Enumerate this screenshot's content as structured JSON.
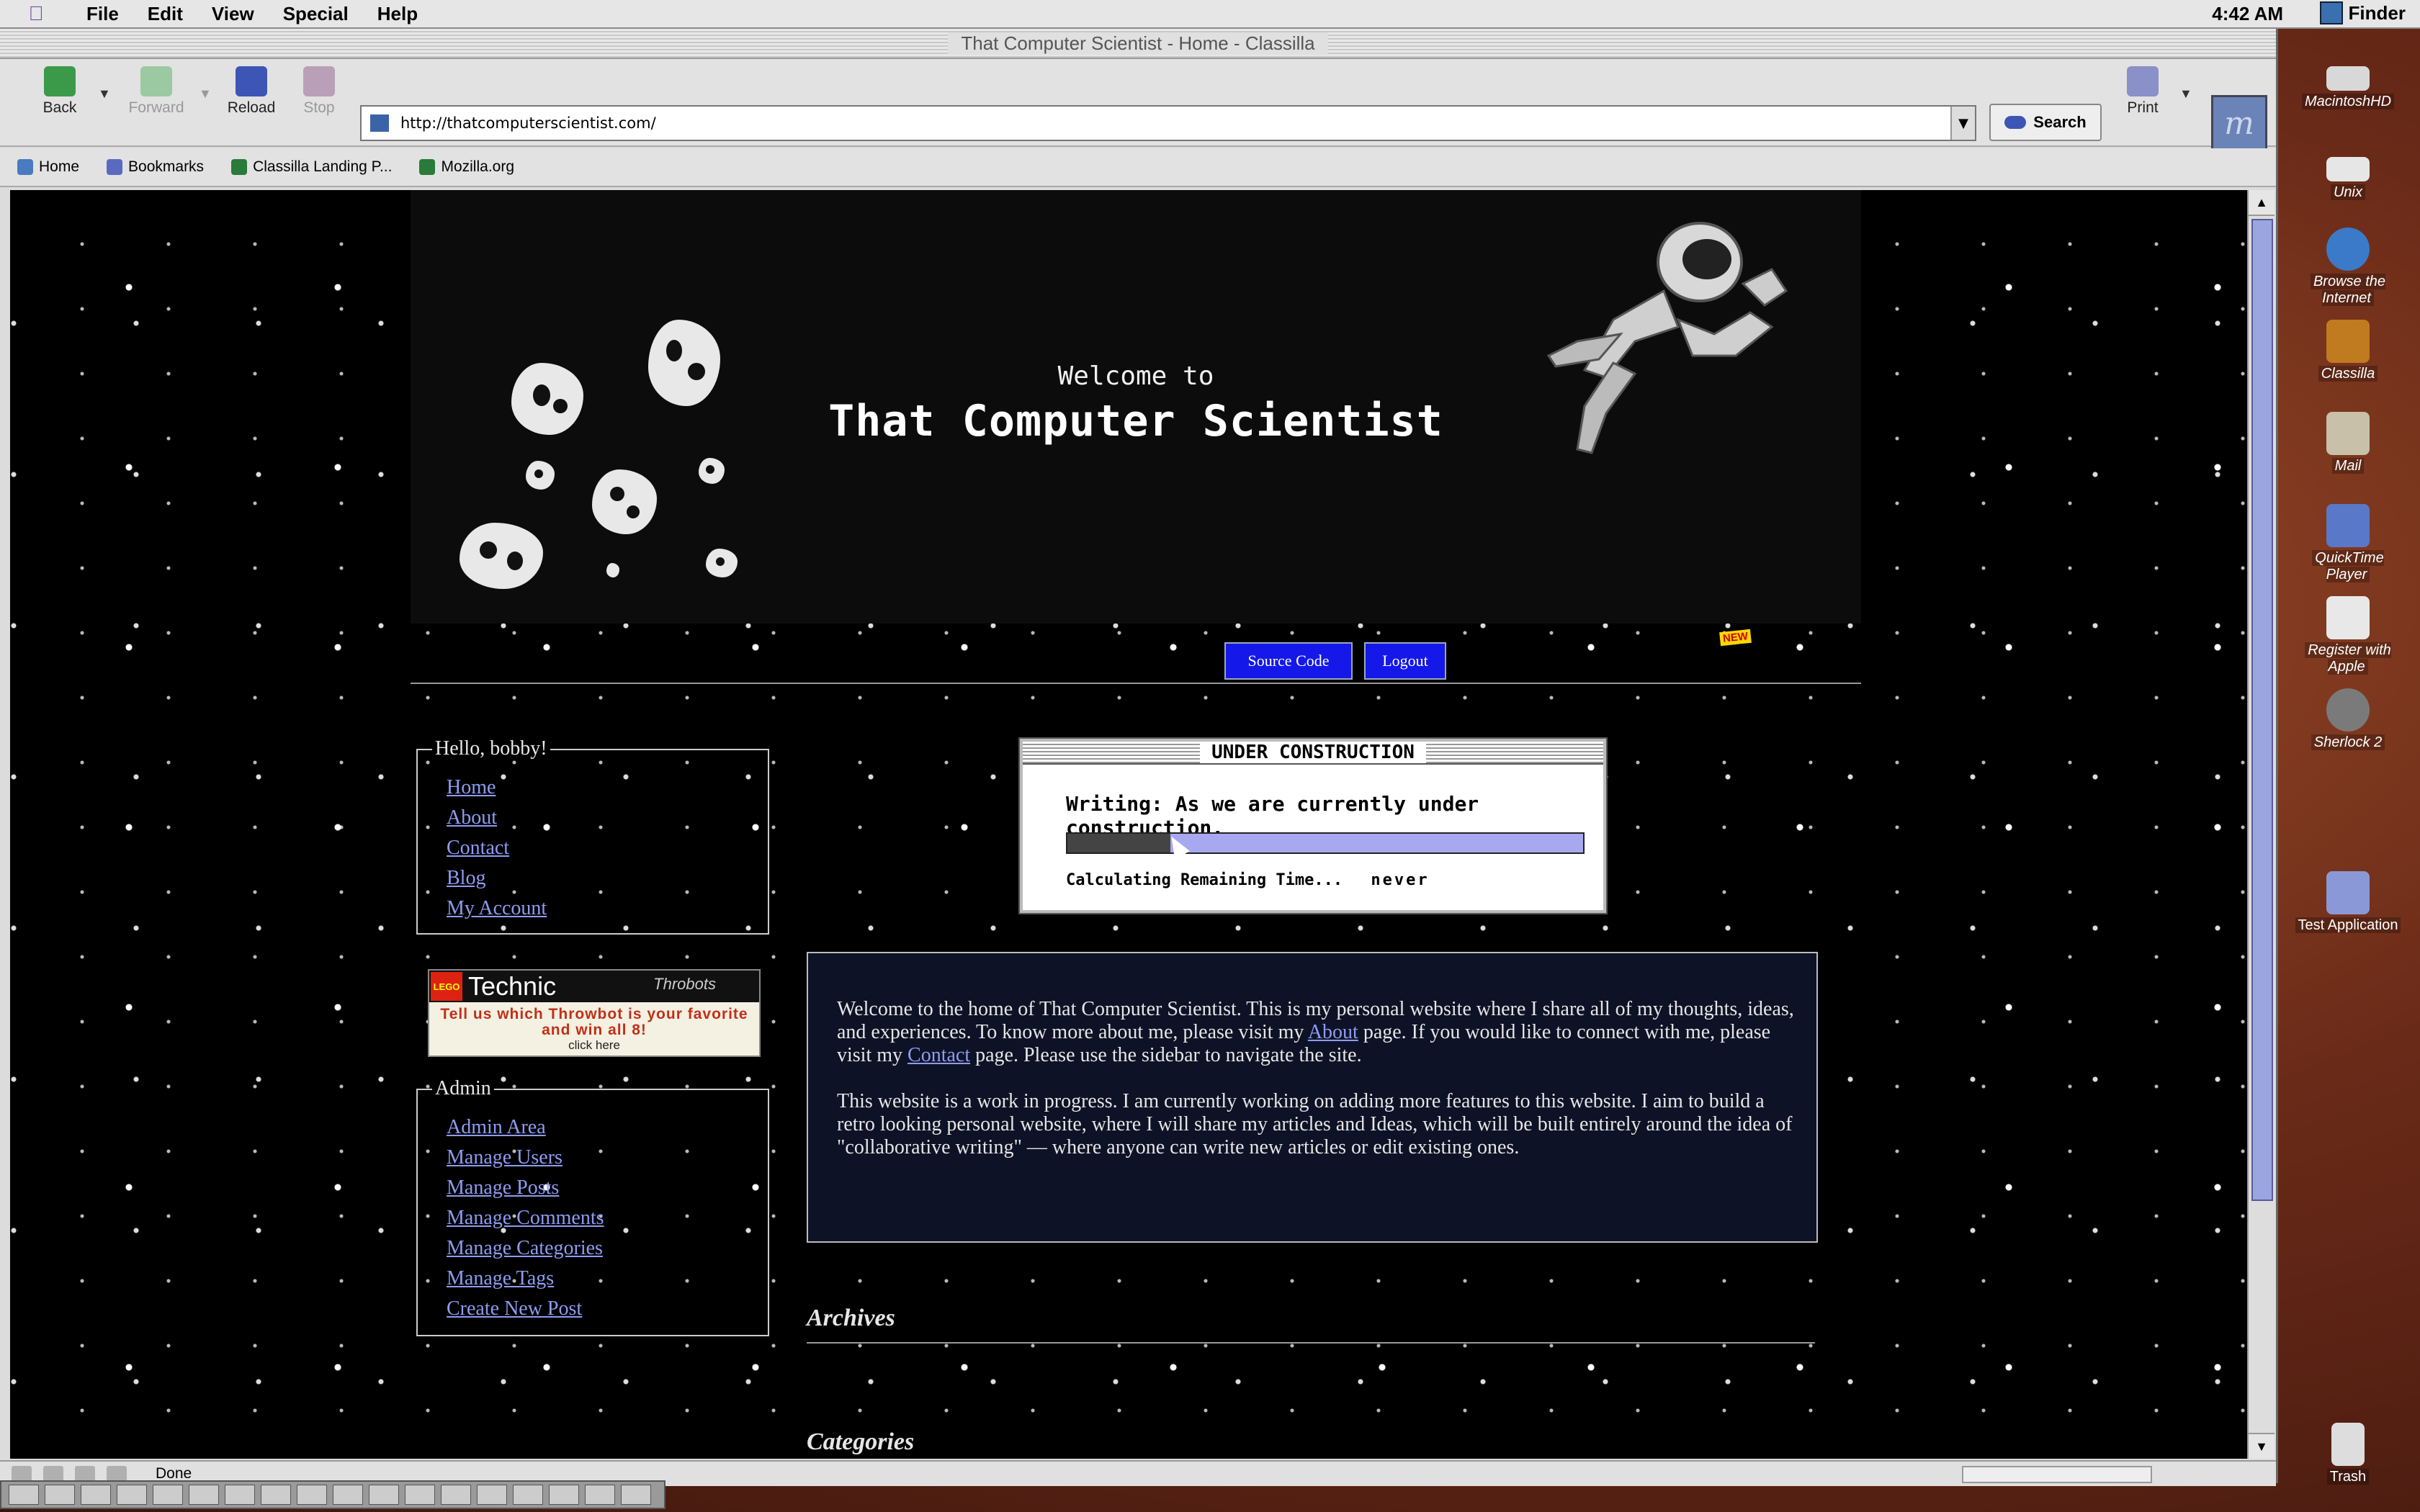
{
  "menubar": {
    "items": [
      "File",
      "Edit",
      "View",
      "Special",
      "Help"
    ],
    "clock": "4:42 AM",
    "app": "Finder"
  },
  "window": {
    "title": "That Computer Scientist - Home - Classilla"
  },
  "toolbar": {
    "back": "Back",
    "forward": "Forward",
    "reload": "Reload",
    "stop": "Stop",
    "url": "http://thatcomputerscientist.com/",
    "search": "Search",
    "print": "Print"
  },
  "bookmarks": [
    "Home",
    "Bookmarks",
    "Classilla Landing P...",
    "Mozilla.org"
  ],
  "status": {
    "text": "Done"
  },
  "page": {
    "hero": {
      "welcome": "Welcome to",
      "title": "That Computer Scientist"
    },
    "nav": {
      "source_code": "Source Code",
      "new_badge": "NEW",
      "logout": "Logout"
    },
    "greeting": {
      "legend": "Hello, bobby!",
      "links": [
        "Home",
        "About",
        "Contact",
        "Blog",
        "My Account"
      ]
    },
    "ad": {
      "brand": "Technic",
      "sub_brand": "Throbots",
      "logo": "LEGO",
      "message": "Tell us which Throwbot is your favorite and win all 8!",
      "click": "click here"
    },
    "admin": {
      "legend": "Admin",
      "links": [
        "Admin Area",
        "Manage Users",
        "Manage Posts",
        "Manage Comments",
        "Manage Categories",
        "Manage Tags",
        "Create New Post"
      ]
    },
    "under_construction": {
      "title": "UNDER CONSTRUCTION",
      "writing": "Writing: As we are currently under construction.",
      "calc_label": "Calculating Remaining Time...",
      "calc_value": "never",
      "progress": 0.2
    },
    "intro": {
      "p1_a": "Welcome to the home of That Computer Scientist. This is my personal website where I share all of my thoughts, ideas, and experiences. To know more about me, please visit my ",
      "p1_about": "About",
      "p1_b": " page. If you would like to connect with me, please visit my ",
      "p1_contact": "Contact",
      "p1_c": " page. Please use the sidebar to navigate the site.",
      "p2": "This website is a work in progress. I am currently working on adding more features to this website. I aim to build a retro looking personal website, where I will share my articles and Ideas, which will be built entirely around the idea of \"collaborative writing\" — where anyone can write new articles or edit existing ones."
    },
    "archives": "Archives",
    "categories": "Categories"
  },
  "desktop": {
    "icons": [
      "MacintoshHD",
      "Unix",
      "Browse the Internet",
      "Classilla",
      "Mail",
      "QuickTime Player",
      "Register with Apple",
      "Sherlock 2",
      "Test Application",
      "Trash"
    ]
  }
}
